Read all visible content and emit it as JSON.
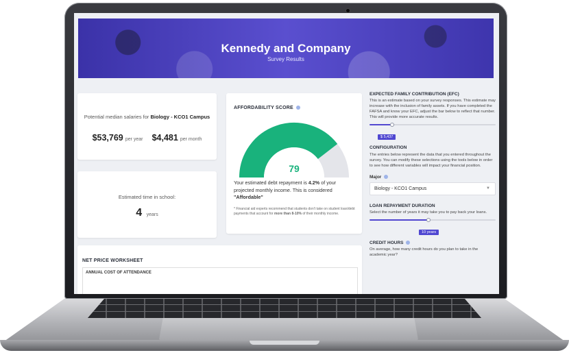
{
  "hero": {
    "title": "Kennedy and Company",
    "subtitle": "Survey Results"
  },
  "salary": {
    "intro": "Potential median salaries for",
    "program": "Biology - KCO1 Campus",
    "year_amount": "$53,769",
    "year_unit": "per year",
    "month_amount": "$4,481",
    "month_unit": "per month"
  },
  "time_in_school": {
    "label": "Estimated time in school:",
    "value": "4",
    "unit": "years"
  },
  "affordability": {
    "title": "AFFORDABILITY SCORE",
    "score": "79",
    "score_fraction": 0.79,
    "text_before": "Your estimated debt repayment is",
    "percent": "4.2%",
    "text_after": "of your projected monthly income. This is considered",
    "rating": "\"Affordable\"",
    "note_before": "* Financial aid experts recommend that students don't take on student loan/debt payments that account for",
    "note_bold": "more than 8-10%",
    "note_after": "of their monthly income.",
    "colors": {
      "filled": "#19b27c",
      "empty": "#e4e5ea"
    }
  },
  "worksheet": {
    "title": "NET PRICE WORKSHEET",
    "subtitle": "ANNUAL COST OF ATTENDANCE"
  },
  "panel": {
    "efc": {
      "title": "EXPECTED FAMILY CONTRIBUTION (EFC)",
      "text": "This is an estimate based on your survey responses. This estimate may increase with the inclusion of family assets. If you have completed the FAFSA and know your EFC, adjust the bar below to reflect that number. This will provide more accurate results.",
      "value_label": "$ 5,437",
      "slider_fraction": 0.18
    },
    "configuration": {
      "title": "CONFIGURATION",
      "text": "The entries below represent the data that you entered throughout the survey. You can modify these selections using the tools below in order to see how different variables will impact your financial position."
    },
    "major": {
      "label": "Major",
      "selected": "Biology - KCO1 Campus"
    },
    "loan": {
      "title": "LOAN REPAYMENT DURATION",
      "text": "Select the number of years it may take you to pay back your loans.",
      "value_label": "10 years",
      "slider_fraction": 0.47
    },
    "credit": {
      "title": "CREDIT HOURS",
      "text": "On average, how many credit hours do you plan to take in the academic year?"
    }
  },
  "accent_color": "#4f47d1"
}
